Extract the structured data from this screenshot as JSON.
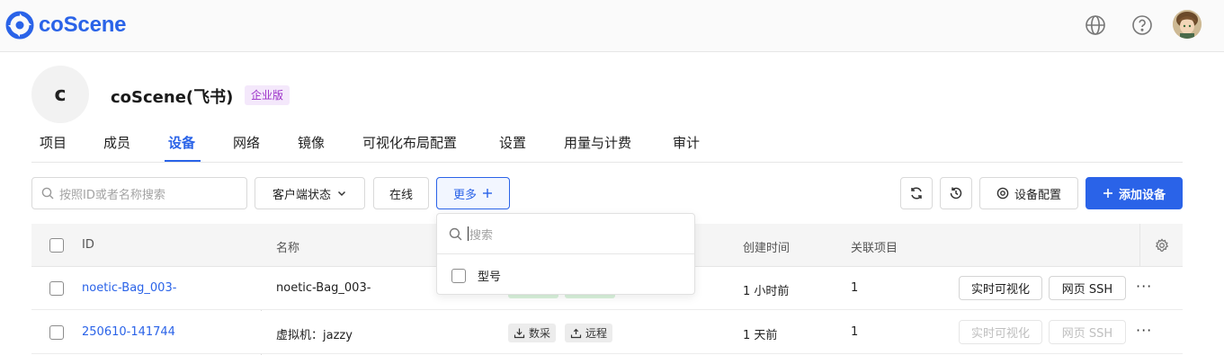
{
  "app": {
    "logo_text": "coScene",
    "accent": "#2a63e8"
  },
  "topbar": {
    "icons": [
      "globe-icon",
      "help-icon",
      "avatar"
    ]
  },
  "org": {
    "initial": "c",
    "name": "coScene(飞书)",
    "badge": "企业版"
  },
  "tabs": [
    {
      "label": "项目",
      "active": false
    },
    {
      "label": "成员",
      "active": false
    },
    {
      "label": "设备",
      "active": true
    },
    {
      "label": "网络",
      "active": false
    },
    {
      "label": "镜像",
      "active": false
    },
    {
      "label": "可视化布局配置",
      "active": false
    },
    {
      "label": "设置",
      "active": false
    },
    {
      "label": "用量与计费",
      "active": false
    },
    {
      "label": "审计",
      "active": false
    }
  ],
  "toolbar": {
    "search_placeholder": "按照ID或者名称搜索",
    "client_status_label": "客户端状态",
    "online_label": "在线",
    "more_label": "更多",
    "device_config_label": "设备配置",
    "add_device_label": "添加设备"
  },
  "dropdown": {
    "search_placeholder": "搜索",
    "options": [
      {
        "label": "型号",
        "checked": false
      }
    ]
  },
  "table": {
    "columns": [
      "ID",
      "名称",
      "创建时间",
      "关联项目"
    ],
    "rows": [
      {
        "id": "noetic-Bag_003-",
        "name": "noetic-Bag_003-",
        "tags": [
          "",
          ""
        ],
        "created": "1 小时前",
        "projects": "1",
        "actions": [
          "实时可视化",
          "网页 SSH"
        ],
        "actions_enabled": true
      },
      {
        "id": "250610-141744",
        "name": "虚拟机：jazzy",
        "tags": [
          "数采",
          "远程"
        ],
        "created": "1 天前",
        "projects": "1",
        "actions": [
          "实时可视化",
          "网页 SSH"
        ],
        "actions_enabled": false
      }
    ],
    "more_glyph": "···"
  }
}
